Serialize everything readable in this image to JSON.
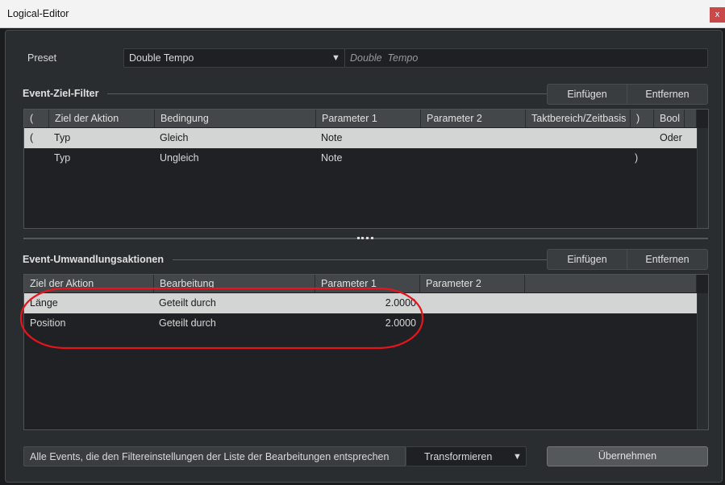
{
  "window": {
    "title": "Logical-Editor",
    "close": "x"
  },
  "preset": {
    "label": "Preset",
    "value": "Double Tempo",
    "name": "Double  Tempo",
    "arrow": "▼"
  },
  "filter": {
    "title": "Event-Ziel-Filter",
    "insert": "Einfügen",
    "remove": "Entfernen",
    "columns": [
      "(",
      "Ziel der Aktion",
      "Bedingung",
      "Parameter 1",
      "Parameter 2",
      "Taktbereich/Zeitbasis",
      ")",
      "Bool"
    ],
    "rows": [
      [
        "(",
        "Typ",
        "Gleich",
        "Note",
        "",
        "",
        "",
        "Oder"
      ],
      [
        "",
        "Typ",
        "Ungleich",
        "Note",
        "",
        "",
        ")",
        ""
      ]
    ]
  },
  "actions": {
    "title": "Event-Umwandlungsaktionen",
    "insert": "Einfügen",
    "remove": "Entfernen",
    "columns": [
      "Ziel der Aktion",
      "Bearbeitung",
      "Parameter 1",
      "Parameter 2"
    ],
    "rows": [
      [
        "Länge",
        "Geteilt durch",
        "2.0000",
        ""
      ],
      [
        "Position",
        "Geteilt durch",
        "2.0000",
        ""
      ]
    ]
  },
  "footer": {
    "description": "Alle Events, die den Filtereinstellungen der Liste der Bearbeitungen entsprechen",
    "mode": "Transformieren",
    "arrow": "▼",
    "apply": "Übernehmen"
  },
  "annotation_color": "#e8141c"
}
